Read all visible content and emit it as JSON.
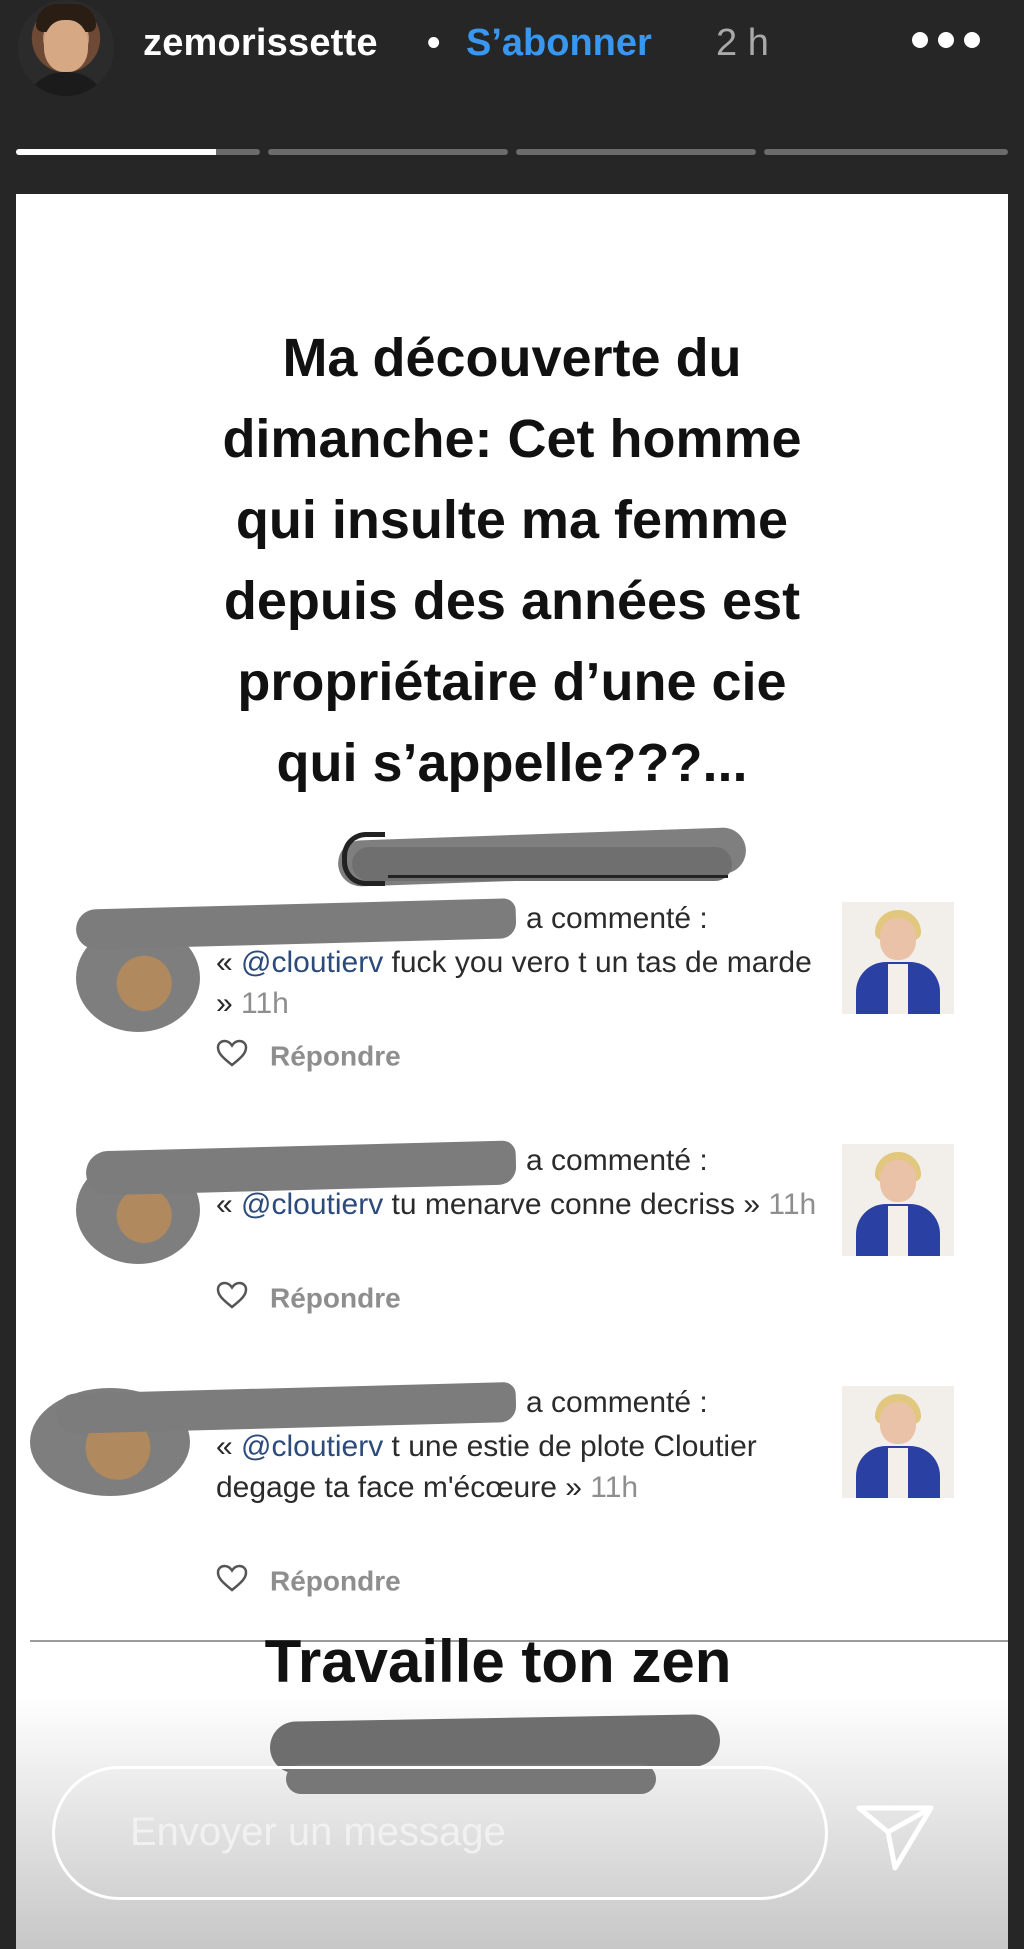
{
  "header": {
    "username": "zemorissette",
    "separator": "•",
    "follow_label": "S’abonner",
    "time": "2 h",
    "avatar_icon": "profile-avatar",
    "more_icon": "more-horizontal-icon"
  },
  "progress": {
    "segments": 4,
    "active_index": 0,
    "active_fraction": 0.82
  },
  "story": {
    "headline": "Ma découverte du\ndimanche: Cet homme\nqui insulte ma femme\ndepuis des années est\npropriétaire d’une cie\nqui s’appelle???...",
    "comments": [
      {
        "action": "a commenté :",
        "open_quote": "« ",
        "mention": "@cloutierv",
        "text": " fuck you vero t un tas de marde »",
        "time": " 11h",
        "reply_label": "Répondre"
      },
      {
        "action": "a commenté :",
        "open_quote": "« ",
        "mention": "@cloutierv",
        "text": " tu menarve conne decriss »",
        "time": " 11h",
        "reply_label": "Répondre"
      },
      {
        "action": "a commenté :",
        "open_quote": "« ",
        "mention": "@cloutierv",
        "text": " t une estie de plote Cloutier degage ta face m'écœure »",
        "time": " 11h",
        "reply_label": "Répondre"
      }
    ],
    "footer_title": "Travaille ton zen"
  },
  "message": {
    "placeholder": "Envoyer un message",
    "send_icon": "send-icon"
  },
  "colors": {
    "background": "#262626",
    "follow": "#3897f0",
    "mention": "#2c4b7a"
  }
}
